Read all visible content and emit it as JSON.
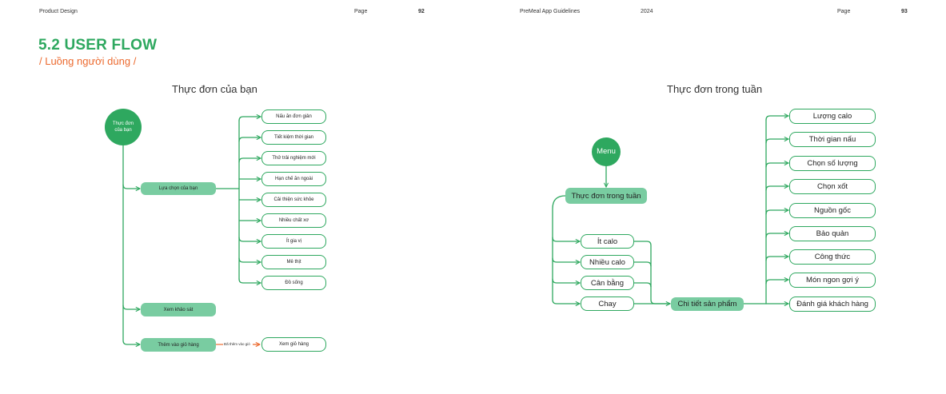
{
  "header": {
    "left_section": "Product Design",
    "left_page_label": "Page",
    "left_page_number": "92",
    "center_title": "PreMeal App Guidelines",
    "year": "2024",
    "right_page_label": "Page",
    "right_page_number": "93"
  },
  "section": {
    "title": "5.2 USER FLOW",
    "subtitle": "/ Luồng người dùng /"
  },
  "colors": {
    "green": "#2ea85f",
    "light_green": "#79cca1",
    "orange": "#ec6a2f"
  },
  "diagram_left": {
    "title": "Thực đơn của bạn",
    "start": "Thực đơn của bạn",
    "choice": "Lựa chọn của bạn",
    "options": [
      "Nấu ăn đơn giản",
      "Tiết kiệm thời gian",
      "Thử trải nghiệm mới",
      "Hạn chế ăn ngoài",
      "Cải thiện sức khỏe",
      "Nhiều chất xơ",
      "Ít gia vị",
      "Mê thịt",
      "Đồ sống"
    ],
    "survey": "Xem khảo sát",
    "add_to_cart": "Thêm vào giỏ hàng",
    "edge_label": "Đã thêm vào giỏ",
    "view_cart": "Xem giỏ hàng"
  },
  "diagram_right": {
    "title": "Thực đơn trong tuần",
    "start": "Menu",
    "weekly": "Thực đơn trong tuần",
    "filters": [
      "Ít calo",
      "Nhiều calo",
      "Cân bằng",
      "Chay"
    ],
    "detail": "Chi tiết sản phẩm",
    "attributes": [
      "Lượng calo",
      "Thời gian nấu",
      "Chọn số lượng",
      "Chọn xốt",
      "Nguồn gốc",
      "Bảo quản",
      "Công thức",
      "Món ngon gợi ý",
      "Đánh giá khách hàng"
    ]
  }
}
